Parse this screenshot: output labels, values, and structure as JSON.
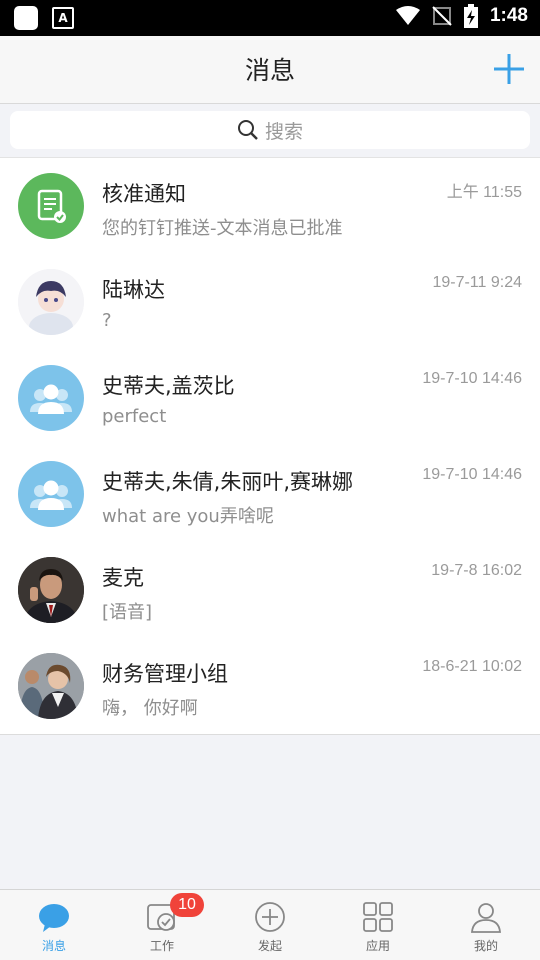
{
  "status_bar": {
    "time": "1:48"
  },
  "header": {
    "title": "消息"
  },
  "search": {
    "placeholder": "搜索"
  },
  "conversations": [
    {
      "name": "核准通知",
      "message": "您的钉钉推送-文本消息已批准",
      "time": "上午 11:55",
      "avatar": "approval-icon"
    },
    {
      "name": "陆琳达",
      "message": "?",
      "time": "19-7-11 9:24",
      "avatar": "avatar-anime"
    },
    {
      "name": "史蒂夫,盖茨比",
      "message": "perfect",
      "time": "19-7-10 14:46",
      "avatar": "group-icon"
    },
    {
      "name": "史蒂夫,朱倩,朱丽叶,赛琳娜",
      "message": "what are you弄啥呢",
      "time": "19-7-10 14:46",
      "avatar": "group-icon"
    },
    {
      "name": "麦克",
      "message": "[语音]",
      "time": "19-7-8 16:02",
      "avatar": "avatar-man-suit"
    },
    {
      "name": "财务管理小组",
      "message": "嗨， 你好啊",
      "time": "18-6-21 10:02",
      "avatar": "avatar-business-group"
    }
  ],
  "tabbar": {
    "tabs": [
      {
        "label": "消息",
        "icon": "chat-bubble-icon",
        "active": true
      },
      {
        "label": "工作",
        "icon": "work-check-icon",
        "badge": "10"
      },
      {
        "label": "发起",
        "icon": "add-circle-icon"
      },
      {
        "label": "应用",
        "icon": "apps-grid-icon"
      },
      {
        "label": "我的",
        "icon": "profile-icon"
      }
    ]
  },
  "colors": {
    "accent": "#3aa0e6",
    "badge": "#f0433a",
    "approval": "#5cb85c",
    "group_avatar": "#7dc3ea"
  }
}
